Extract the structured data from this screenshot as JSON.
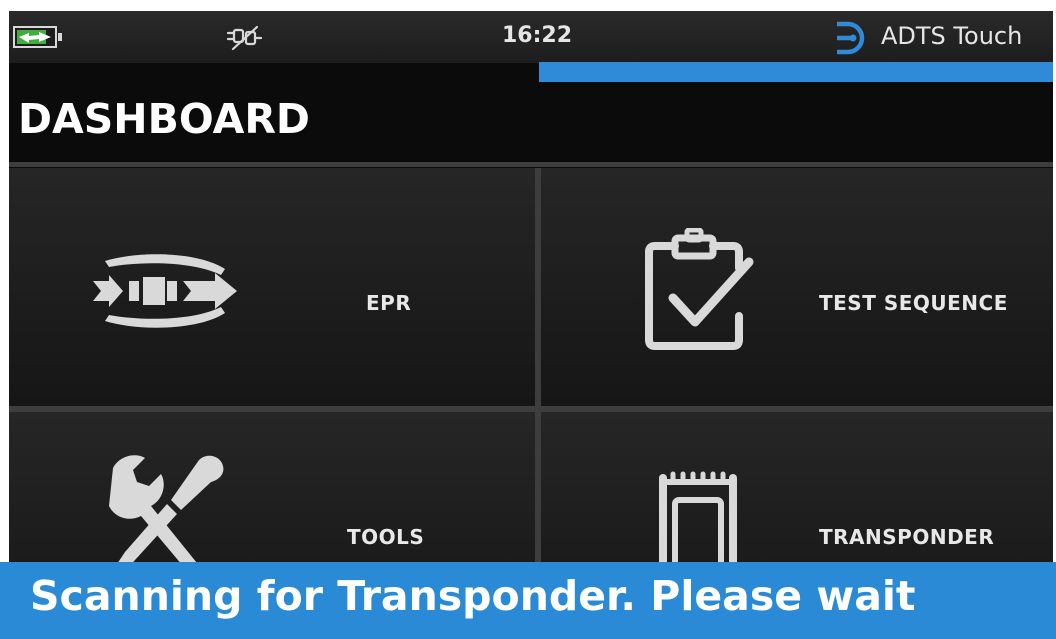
{
  "status_bar": {
    "battery_level": 0.8,
    "battery_icon": "battery-charging-icon",
    "connection_icon": "plug-disconnected-icon",
    "time": "16:22",
    "brand_icon": "druck-logo-icon",
    "brand_name": "ADTS Touch",
    "progress": 1.0
  },
  "page_title": "DASHBOARD",
  "tiles": [
    {
      "label": "EPR",
      "icon": "epr-engine-icon"
    },
    {
      "label": "TEST SEQUENCE",
      "icon": "clipboard-check-icon"
    },
    {
      "label": "TOOLS",
      "icon": "wrench-screwdriver-icon"
    },
    {
      "label": "TRANSPONDER",
      "icon": "transponder-icon"
    }
  ],
  "banner": {
    "message": "Scanning for Transponder. Please wait"
  },
  "colors": {
    "accent": "#2a8ad6",
    "background": "#0b0b0b",
    "tile": "#1f1f1f",
    "battery_fill": "#3fae3f",
    "text": "#e8e8e8"
  }
}
